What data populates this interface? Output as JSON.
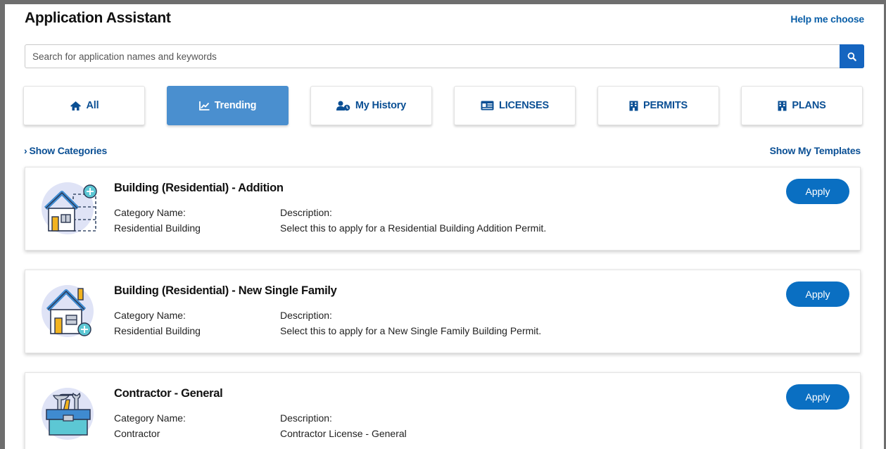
{
  "header": {
    "title": "Application Assistant",
    "help_link": "Help me choose"
  },
  "search": {
    "placeholder": "Search for application names and keywords",
    "value": ""
  },
  "tabs": [
    {
      "label": "All",
      "icon": "home-icon",
      "active": false
    },
    {
      "label": "Trending",
      "icon": "trending-chart-icon",
      "active": true
    },
    {
      "label": "My History",
      "icon": "user-history-icon",
      "active": false
    },
    {
      "label": "LICENSES",
      "icon": "id-card-icon",
      "active": false
    },
    {
      "label": "PERMITS",
      "icon": "building-icon",
      "active": false
    },
    {
      "label": "PLANS",
      "icon": "building-icon",
      "active": false
    }
  ],
  "links": {
    "show_categories": "Show Categories",
    "show_templates": "Show My Templates"
  },
  "labels": {
    "category": "Category Name:",
    "description": "Description:"
  },
  "cards": [
    {
      "name": "Building (Residential) - Addition",
      "category": "Residential Building",
      "description": "Select this to apply for a Residential Building Addition Permit.",
      "apply": "Apply",
      "icon": "house-addition-icon"
    },
    {
      "name": "Building (Residential) - New Single Family",
      "category": "Residential Building",
      "description": "Select this to apply for a New Single Family Building Permit.",
      "apply": "Apply",
      "icon": "house-new-icon"
    },
    {
      "name": "Contractor - General",
      "category": "Contractor",
      "description": "Contractor License - General",
      "apply": "Apply",
      "icon": "toolbox-icon"
    }
  ],
  "colors": {
    "accent": "#0a6fc2",
    "active_tab": "#4a8fcf",
    "link": "#0a4f94",
    "frame": "#6e6e6e"
  }
}
